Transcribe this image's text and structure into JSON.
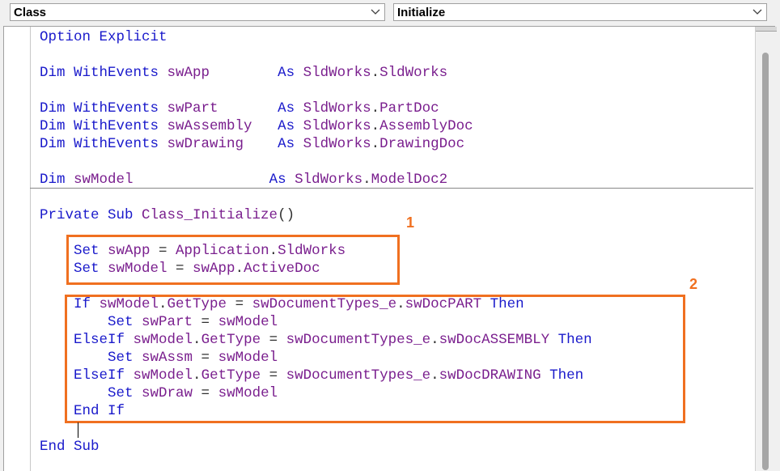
{
  "toolbar": {
    "object_combo_value": "Class",
    "procedure_combo_value": "Initialize"
  },
  "code": {
    "lines": [
      [
        {
          "t": "Option Explicit",
          "c": "kw"
        }
      ],
      [],
      [
        {
          "t": "Dim WithEvents ",
          "c": "kw"
        },
        {
          "t": "swApp",
          "c": "id"
        },
        {
          "t": "        ",
          "c": "pl"
        },
        {
          "t": "As ",
          "c": "kw"
        },
        {
          "t": "SldWorks",
          "c": "id"
        },
        {
          "t": ".",
          "c": "pl"
        },
        {
          "t": "SldWorks",
          "c": "id"
        }
      ],
      [],
      [
        {
          "t": "Dim WithEvents ",
          "c": "kw"
        },
        {
          "t": "swPart",
          "c": "id"
        },
        {
          "t": "       ",
          "c": "pl"
        },
        {
          "t": "As ",
          "c": "kw"
        },
        {
          "t": "SldWorks",
          "c": "id"
        },
        {
          "t": ".",
          "c": "pl"
        },
        {
          "t": "PartDoc",
          "c": "id"
        }
      ],
      [
        {
          "t": "Dim WithEvents ",
          "c": "kw"
        },
        {
          "t": "swAssembly",
          "c": "id"
        },
        {
          "t": "   ",
          "c": "pl"
        },
        {
          "t": "As ",
          "c": "kw"
        },
        {
          "t": "SldWorks",
          "c": "id"
        },
        {
          "t": ".",
          "c": "pl"
        },
        {
          "t": "AssemblyDoc",
          "c": "id"
        }
      ],
      [
        {
          "t": "Dim WithEvents ",
          "c": "kw"
        },
        {
          "t": "swDrawing",
          "c": "id"
        },
        {
          "t": "    ",
          "c": "pl"
        },
        {
          "t": "As ",
          "c": "kw"
        },
        {
          "t": "SldWorks",
          "c": "id"
        },
        {
          "t": ".",
          "c": "pl"
        },
        {
          "t": "DrawingDoc",
          "c": "id"
        }
      ],
      [],
      [
        {
          "t": "Dim ",
          "c": "kw"
        },
        {
          "t": "swModel",
          "c": "id"
        },
        {
          "t": "                ",
          "c": "pl"
        },
        {
          "t": "As ",
          "c": "kw"
        },
        {
          "t": "SldWorks",
          "c": "id"
        },
        {
          "t": ".",
          "c": "pl"
        },
        {
          "t": "ModelDoc2",
          "c": "id"
        }
      ],
      [],
      [
        {
          "t": "Private Sub ",
          "c": "kw"
        },
        {
          "t": "Class_Initialize",
          "c": "id"
        },
        {
          "t": "()",
          "c": "pl"
        }
      ],
      [],
      [
        {
          "t": "    Set ",
          "c": "kw"
        },
        {
          "t": "swApp",
          "c": "id"
        },
        {
          "t": " = ",
          "c": "pl"
        },
        {
          "t": "Application",
          "c": "id"
        },
        {
          "t": ".",
          "c": "pl"
        },
        {
          "t": "SldWorks",
          "c": "id"
        }
      ],
      [
        {
          "t": "    Set ",
          "c": "kw"
        },
        {
          "t": "swModel",
          "c": "id"
        },
        {
          "t": " = ",
          "c": "pl"
        },
        {
          "t": "swApp",
          "c": "id"
        },
        {
          "t": ".",
          "c": "pl"
        },
        {
          "t": "ActiveDoc",
          "c": "id"
        }
      ],
      [],
      [
        {
          "t": "    If ",
          "c": "kw"
        },
        {
          "t": "swModel",
          "c": "id"
        },
        {
          "t": ".",
          "c": "pl"
        },
        {
          "t": "GetType",
          "c": "id"
        },
        {
          "t": " = ",
          "c": "pl"
        },
        {
          "t": "swDocumentTypes_e",
          "c": "id"
        },
        {
          "t": ".",
          "c": "pl"
        },
        {
          "t": "swDocPART",
          "c": "id"
        },
        {
          "t": " Then",
          "c": "kw"
        }
      ],
      [
        {
          "t": "        Set ",
          "c": "kw"
        },
        {
          "t": "swPart",
          "c": "id"
        },
        {
          "t": " = ",
          "c": "pl"
        },
        {
          "t": "swModel",
          "c": "id"
        }
      ],
      [
        {
          "t": "    ElseIf ",
          "c": "kw"
        },
        {
          "t": "swModel",
          "c": "id"
        },
        {
          "t": ".",
          "c": "pl"
        },
        {
          "t": "GetType",
          "c": "id"
        },
        {
          "t": " = ",
          "c": "pl"
        },
        {
          "t": "swDocumentTypes_e",
          "c": "id"
        },
        {
          "t": ".",
          "c": "pl"
        },
        {
          "t": "swDocASSEMBLY",
          "c": "id"
        },
        {
          "t": " Then",
          "c": "kw"
        }
      ],
      [
        {
          "t": "        Set ",
          "c": "kw"
        },
        {
          "t": "swAssm",
          "c": "id"
        },
        {
          "t": " = ",
          "c": "pl"
        },
        {
          "t": "swModel",
          "c": "id"
        }
      ],
      [
        {
          "t": "    ElseIf ",
          "c": "kw"
        },
        {
          "t": "swModel",
          "c": "id"
        },
        {
          "t": ".",
          "c": "pl"
        },
        {
          "t": "GetType",
          "c": "id"
        },
        {
          "t": " = ",
          "c": "pl"
        },
        {
          "t": "swDocumentTypes_e",
          "c": "id"
        },
        {
          "t": ".",
          "c": "pl"
        },
        {
          "t": "swDocDRAWING",
          "c": "id"
        },
        {
          "t": " Then",
          "c": "kw"
        }
      ],
      [
        {
          "t": "        Set ",
          "c": "kw"
        },
        {
          "t": "swDraw",
          "c": "id"
        },
        {
          "t": " = ",
          "c": "pl"
        },
        {
          "t": "swModel",
          "c": "id"
        }
      ],
      [
        {
          "t": "    End If",
          "c": "kw"
        }
      ],
      [],
      [
        {
          "t": "End Sub",
          "c": "kw"
        }
      ]
    ]
  },
  "annotations": {
    "label_1": "1",
    "label_2": "2",
    "color": "#f07020"
  },
  "colors": {
    "keyword": "#1a1acb",
    "identifier": "#7a1f8e"
  },
  "icons": {
    "combo_arrow": "chevron-down-icon"
  }
}
